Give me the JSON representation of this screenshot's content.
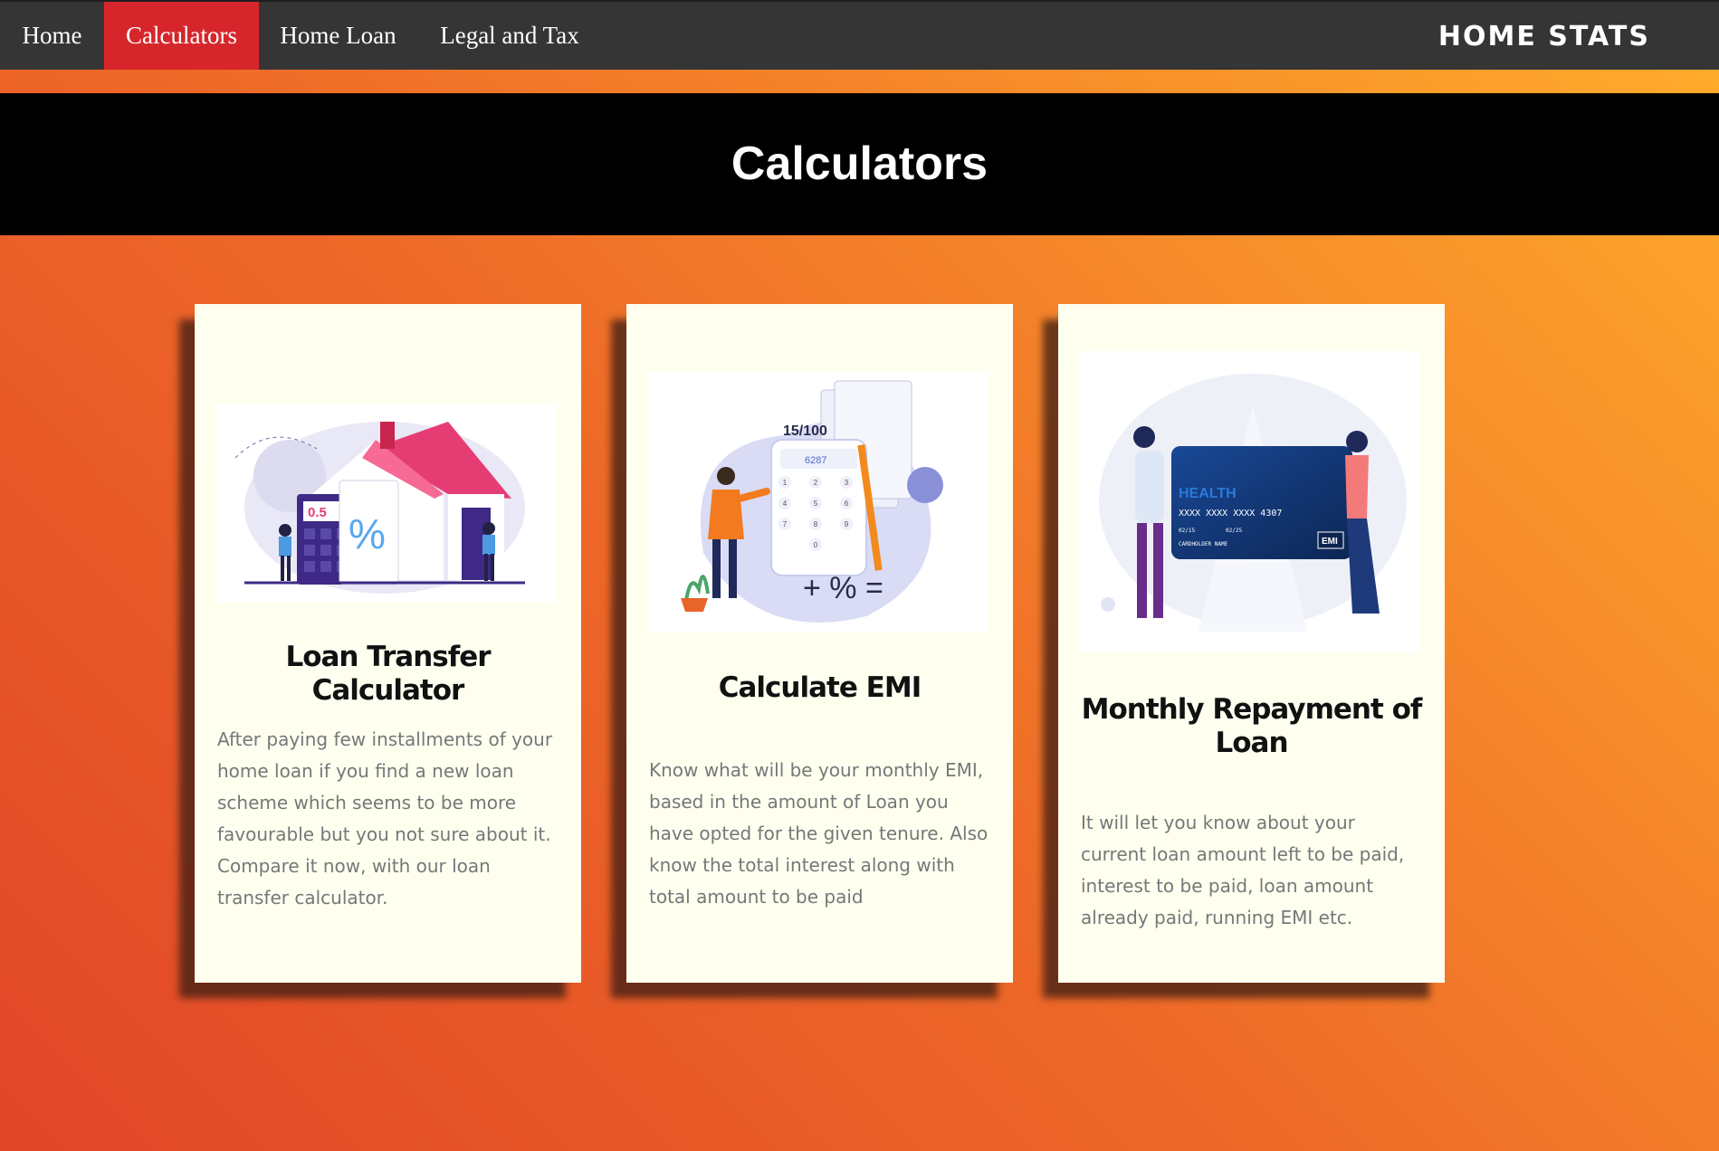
{
  "nav": {
    "items": [
      {
        "label": "Home"
      },
      {
        "label": "Calculators"
      },
      {
        "label": "Home Loan"
      },
      {
        "label": "Legal and Tax"
      }
    ],
    "brand": "HOME STATS"
  },
  "banner": {
    "title": "Calculators"
  },
  "cards": [
    {
      "title": "Loan Transfer Calculator",
      "description": "After paying few installments of your home loan if you find a new loan scheme which seems to be more favourable but you not sure about it. Compare it now, with our loan transfer calculator.",
      "illustration": {
        "icon": "house-percent-illustration",
        "texts": [
          "0.5",
          "%"
        ]
      }
    },
    {
      "title": "Calculate EMI",
      "description": "Know what will be your monthly EMI, based in the amount of Loan you have opted for the given tenure. Also know the total interest along with total amount to be paid",
      "illustration": {
        "icon": "calculator-illustration",
        "texts": [
          "15/100",
          "6287",
          "1",
          "2",
          "3",
          "4",
          "5",
          "6",
          "7",
          "8",
          "9",
          "0",
          "+ % ="
        ]
      }
    },
    {
      "title": "Monthly Repayment of Loan",
      "description": "It will let you know about your current loan amount left to be paid, interest to be paid, loan amount already paid, running EMI etc.",
      "illustration": {
        "icon": "emi-card-illustration",
        "texts": [
          "HEALTH",
          "XXXX XXXX XXXX 4307",
          "02/15",
          "02/25",
          "CARDHOLDER NAME",
          "EMI"
        ]
      }
    }
  ],
  "colors": {
    "nav_bg": "#353535",
    "nav_active": "#d6262b",
    "banner_bg": "#000000",
    "card_bg": "#fffff0",
    "gradient_start": "#e04528",
    "gradient_end": "#ffad2c"
  }
}
